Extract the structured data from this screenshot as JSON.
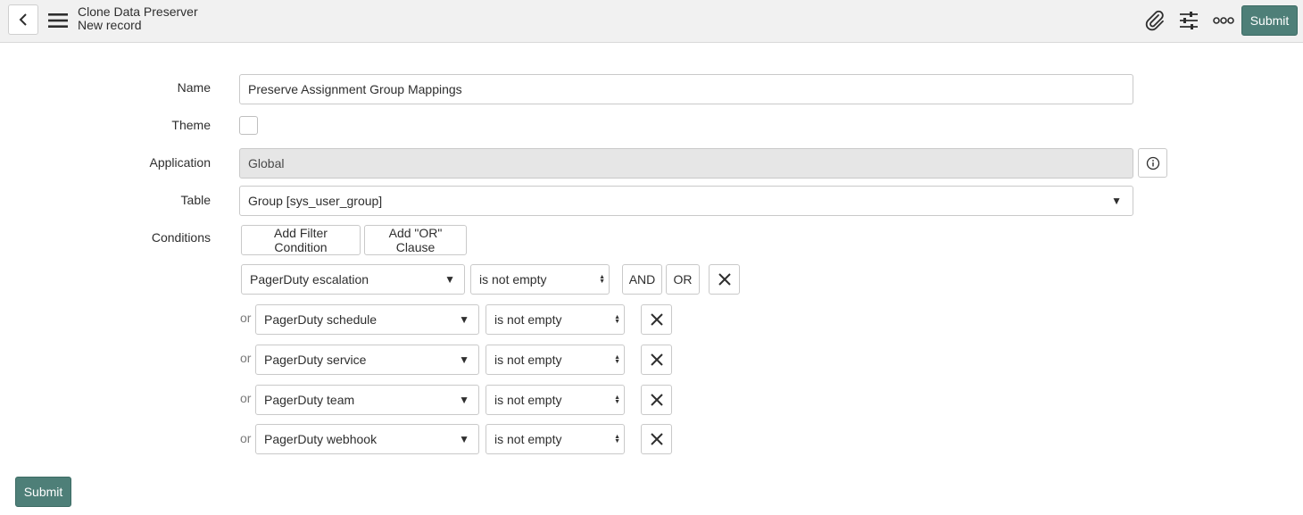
{
  "header": {
    "title": "Clone Data Preserver",
    "subtitle": "New record",
    "submit_label": "Submit",
    "icons": [
      "chevron-left-icon",
      "hamburger-menu-icon",
      "paperclip-icon",
      "sliders-icon",
      "more-icon"
    ]
  },
  "form": {
    "name_label": "Name",
    "name_value": "Preserve Assignment Group Mappings",
    "theme_label": "Theme",
    "application_label": "Application",
    "application_value": "Global",
    "table_label": "Table",
    "table_value": "Group [sys_user_group]",
    "conditions_label": "Conditions",
    "add_filter_label": "Add Filter Condition",
    "add_or_label": "Add \"OR\" Clause",
    "and_label": "AND",
    "or_button_label": "OR",
    "or_text": "or",
    "conditions": [
      {
        "field": "PagerDuty escalation",
        "operator": "is not empty"
      },
      {
        "field": "PagerDuty schedule",
        "operator": "is not empty"
      },
      {
        "field": "PagerDuty service",
        "operator": "is not empty"
      },
      {
        "field": "PagerDuty team",
        "operator": "is not empty"
      },
      {
        "field": "PagerDuty webhook",
        "operator": "is not empty"
      }
    ]
  },
  "footer": {
    "submit_label": "Submit"
  },
  "colors": {
    "accent": "#4e7f78",
    "header_bg": "#f1f1f1",
    "readonly_bg": "#e6e6e6"
  }
}
